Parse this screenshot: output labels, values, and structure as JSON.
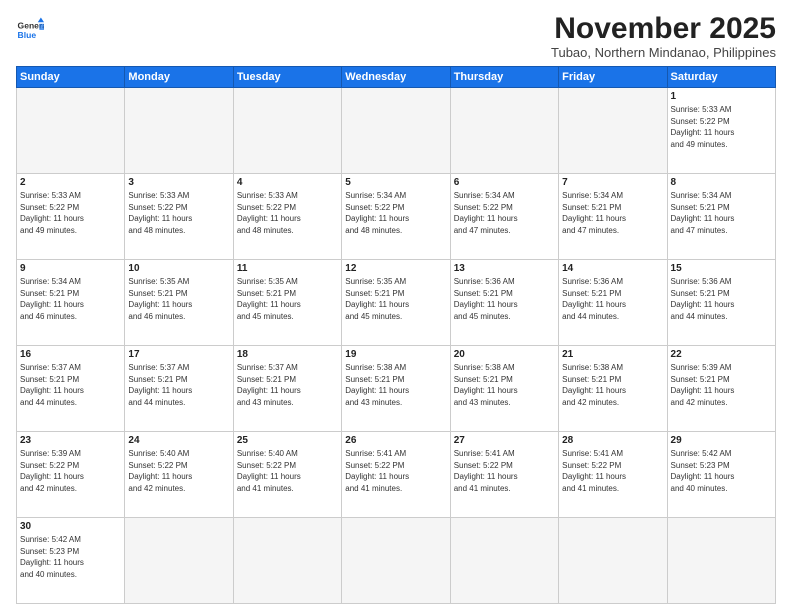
{
  "header": {
    "logo_general": "General",
    "logo_blue": "Blue",
    "month_year": "November 2025",
    "location": "Tubao, Northern Mindanao, Philippines"
  },
  "weekdays": [
    "Sunday",
    "Monday",
    "Tuesday",
    "Wednesday",
    "Thursday",
    "Friday",
    "Saturday"
  ],
  "weeks": [
    [
      {
        "day": "",
        "info": ""
      },
      {
        "day": "",
        "info": ""
      },
      {
        "day": "",
        "info": ""
      },
      {
        "day": "",
        "info": ""
      },
      {
        "day": "",
        "info": ""
      },
      {
        "day": "",
        "info": ""
      },
      {
        "day": "1",
        "info": "Sunrise: 5:33 AM\nSunset: 5:22 PM\nDaylight: 11 hours\nand 49 minutes."
      }
    ],
    [
      {
        "day": "2",
        "info": "Sunrise: 5:33 AM\nSunset: 5:22 PM\nDaylight: 11 hours\nand 49 minutes."
      },
      {
        "day": "3",
        "info": "Sunrise: 5:33 AM\nSunset: 5:22 PM\nDaylight: 11 hours\nand 48 minutes."
      },
      {
        "day": "4",
        "info": "Sunrise: 5:33 AM\nSunset: 5:22 PM\nDaylight: 11 hours\nand 48 minutes."
      },
      {
        "day": "5",
        "info": "Sunrise: 5:34 AM\nSunset: 5:22 PM\nDaylight: 11 hours\nand 48 minutes."
      },
      {
        "day": "6",
        "info": "Sunrise: 5:34 AM\nSunset: 5:22 PM\nDaylight: 11 hours\nand 47 minutes."
      },
      {
        "day": "7",
        "info": "Sunrise: 5:34 AM\nSunset: 5:21 PM\nDaylight: 11 hours\nand 47 minutes."
      },
      {
        "day": "8",
        "info": "Sunrise: 5:34 AM\nSunset: 5:21 PM\nDaylight: 11 hours\nand 47 minutes."
      }
    ],
    [
      {
        "day": "9",
        "info": "Sunrise: 5:34 AM\nSunset: 5:21 PM\nDaylight: 11 hours\nand 46 minutes."
      },
      {
        "day": "10",
        "info": "Sunrise: 5:35 AM\nSunset: 5:21 PM\nDaylight: 11 hours\nand 46 minutes."
      },
      {
        "day": "11",
        "info": "Sunrise: 5:35 AM\nSunset: 5:21 PM\nDaylight: 11 hours\nand 45 minutes."
      },
      {
        "day": "12",
        "info": "Sunrise: 5:35 AM\nSunset: 5:21 PM\nDaylight: 11 hours\nand 45 minutes."
      },
      {
        "day": "13",
        "info": "Sunrise: 5:36 AM\nSunset: 5:21 PM\nDaylight: 11 hours\nand 45 minutes."
      },
      {
        "day": "14",
        "info": "Sunrise: 5:36 AM\nSunset: 5:21 PM\nDaylight: 11 hours\nand 44 minutes."
      },
      {
        "day": "15",
        "info": "Sunrise: 5:36 AM\nSunset: 5:21 PM\nDaylight: 11 hours\nand 44 minutes."
      }
    ],
    [
      {
        "day": "16",
        "info": "Sunrise: 5:37 AM\nSunset: 5:21 PM\nDaylight: 11 hours\nand 44 minutes."
      },
      {
        "day": "17",
        "info": "Sunrise: 5:37 AM\nSunset: 5:21 PM\nDaylight: 11 hours\nand 44 minutes."
      },
      {
        "day": "18",
        "info": "Sunrise: 5:37 AM\nSunset: 5:21 PM\nDaylight: 11 hours\nand 43 minutes."
      },
      {
        "day": "19",
        "info": "Sunrise: 5:38 AM\nSunset: 5:21 PM\nDaylight: 11 hours\nand 43 minutes."
      },
      {
        "day": "20",
        "info": "Sunrise: 5:38 AM\nSunset: 5:21 PM\nDaylight: 11 hours\nand 43 minutes."
      },
      {
        "day": "21",
        "info": "Sunrise: 5:38 AM\nSunset: 5:21 PM\nDaylight: 11 hours\nand 42 minutes."
      },
      {
        "day": "22",
        "info": "Sunrise: 5:39 AM\nSunset: 5:21 PM\nDaylight: 11 hours\nand 42 minutes."
      }
    ],
    [
      {
        "day": "23",
        "info": "Sunrise: 5:39 AM\nSunset: 5:22 PM\nDaylight: 11 hours\nand 42 minutes."
      },
      {
        "day": "24",
        "info": "Sunrise: 5:40 AM\nSunset: 5:22 PM\nDaylight: 11 hours\nand 42 minutes."
      },
      {
        "day": "25",
        "info": "Sunrise: 5:40 AM\nSunset: 5:22 PM\nDaylight: 11 hours\nand 41 minutes."
      },
      {
        "day": "26",
        "info": "Sunrise: 5:41 AM\nSunset: 5:22 PM\nDaylight: 11 hours\nand 41 minutes."
      },
      {
        "day": "27",
        "info": "Sunrise: 5:41 AM\nSunset: 5:22 PM\nDaylight: 11 hours\nand 41 minutes."
      },
      {
        "day": "28",
        "info": "Sunrise: 5:41 AM\nSunset: 5:22 PM\nDaylight: 11 hours\nand 41 minutes."
      },
      {
        "day": "29",
        "info": "Sunrise: 5:42 AM\nSunset: 5:23 PM\nDaylight: 11 hours\nand 40 minutes."
      }
    ],
    [
      {
        "day": "30",
        "info": "Sunrise: 5:42 AM\nSunset: 5:23 PM\nDaylight: 11 hours\nand 40 minutes."
      },
      {
        "day": "",
        "info": ""
      },
      {
        "day": "",
        "info": ""
      },
      {
        "day": "",
        "info": ""
      },
      {
        "day": "",
        "info": ""
      },
      {
        "day": "",
        "info": ""
      },
      {
        "day": "",
        "info": ""
      }
    ]
  ]
}
